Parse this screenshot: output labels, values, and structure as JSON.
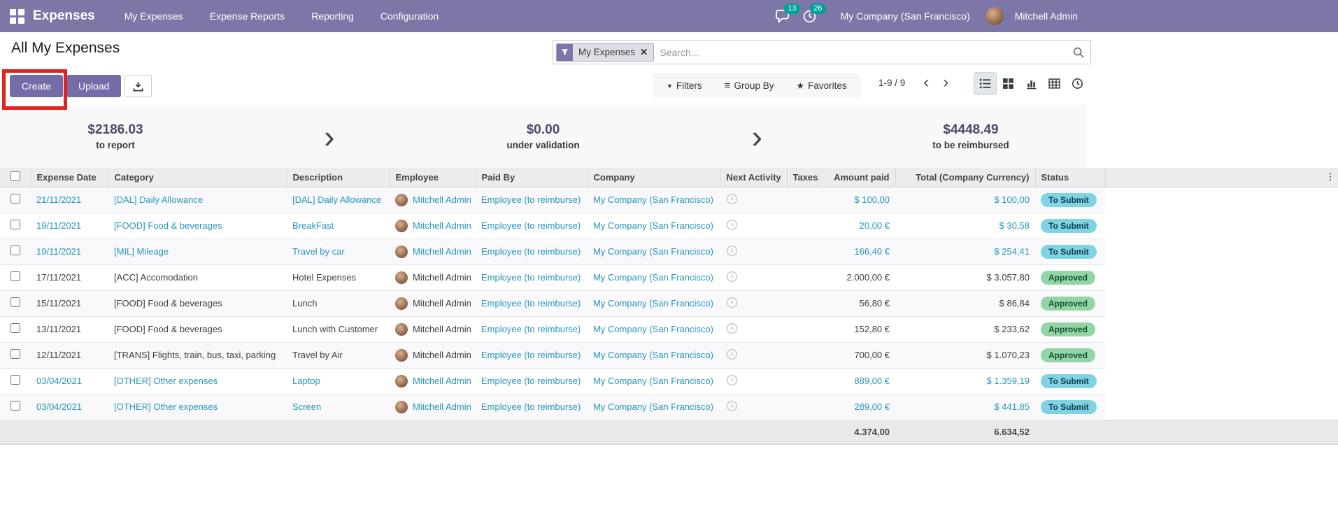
{
  "topbar": {
    "app_name": "Expenses",
    "menus": [
      "My Expenses",
      "Expense Reports",
      "Reporting",
      "Configuration"
    ],
    "messages_count": "13",
    "activities_count": "26",
    "company": "My Company (San Francisco)",
    "user": "Mitchell Admin"
  },
  "control_panel": {
    "title": "All My Expenses",
    "create_label": "Create",
    "upload_label": "Upload",
    "facet_label": "My Expenses",
    "search_placeholder": "Search...",
    "filters_label": "Filters",
    "group_by_label": "Group By",
    "favorites_label": "Favorites",
    "pager": "1-9 / 9"
  },
  "stats": [
    {
      "amount": "$2186.03",
      "label": "to report"
    },
    {
      "amount": "$0.00",
      "label": "under validation"
    },
    {
      "amount": "$4448.49",
      "label": "to be reimbursed"
    }
  ],
  "table": {
    "headers": [
      "Expense Date",
      "Category",
      "Description",
      "Employee",
      "Paid By",
      "Company",
      "Next Activity",
      "Taxes",
      "Amount paid",
      "Total (Company Currency)",
      "Status"
    ],
    "rows": [
      {
        "date": "21/11/2021",
        "category": "[DAL] Daily Allowance",
        "description": "[DAL] Daily Allowance",
        "employee": "Mitchell Admin",
        "paid_by": "Employee (to reimburse)",
        "company": "My Company (San Francisco)",
        "taxes": "",
        "amount_paid": "$ 100,00",
        "total": "$ 100,00",
        "status": "To Submit",
        "state": "to-submit"
      },
      {
        "date": "19/11/2021",
        "category": "[FOOD] Food & beverages",
        "description": "BreakFast",
        "employee": "Mitchell Admin",
        "paid_by": "Employee (to reimburse)",
        "company": "My Company (San Francisco)",
        "taxes": "",
        "amount_paid": "20,00 €",
        "total": "$ 30,58",
        "status": "To Submit",
        "state": "to-submit"
      },
      {
        "date": "19/11/2021",
        "category": "[MIL] Mileage",
        "description": "Travel by car",
        "employee": "Mitchell Admin",
        "paid_by": "Employee (to reimburse)",
        "company": "My Company (San Francisco)",
        "taxes": "",
        "amount_paid": "166,40 €",
        "total": "$ 254,41",
        "status": "To Submit",
        "state": "to-submit"
      },
      {
        "date": "17/11/2021",
        "category": "[ACC] Accomodation",
        "description": "Hotel Expenses",
        "employee": "Mitchell Admin",
        "paid_by": "Employee (to reimburse)",
        "company": "My Company (San Francisco)",
        "taxes": "",
        "amount_paid": "2.000,00 €",
        "total": "$ 3.057,80",
        "status": "Approved",
        "state": "approved"
      },
      {
        "date": "15/11/2021",
        "category": "[FOOD] Food & beverages",
        "description": "Lunch",
        "employee": "Mitchell Admin",
        "paid_by": "Employee (to reimburse)",
        "company": "My Company (San Francisco)",
        "taxes": "",
        "amount_paid": "56,80 €",
        "total": "$ 86,84",
        "status": "Approved",
        "state": "approved"
      },
      {
        "date": "13/11/2021",
        "category": "[FOOD] Food & beverages",
        "description": "Lunch with Customer",
        "employee": "Mitchell Admin",
        "paid_by": "Employee (to reimburse)",
        "company": "My Company (San Francisco)",
        "taxes": "",
        "amount_paid": "152,80 €",
        "total": "$ 233,62",
        "status": "Approved",
        "state": "approved"
      },
      {
        "date": "12/11/2021",
        "category": "[TRANS] Flights, train, bus, taxi, parking",
        "description": "Travel by Air",
        "employee": "Mitchell Admin",
        "paid_by": "Employee (to reimburse)",
        "company": "My Company (San Francisco)",
        "taxes": "",
        "amount_paid": "700,00 €",
        "total": "$ 1.070,23",
        "status": "Approved",
        "state": "approved"
      },
      {
        "date": "03/04/2021",
        "category": "[OTHER] Other expenses",
        "description": "Laptop",
        "employee": "Mitchell Admin",
        "paid_by": "Employee (to reimburse)",
        "company": "My Company (San Francisco)",
        "taxes": "",
        "amount_paid": "889,00 €",
        "total": "$ 1.359,19",
        "status": "To Submit",
        "state": "to-submit"
      },
      {
        "date": "03/04/2021",
        "category": "[OTHER] Other expenses",
        "description": "Screen",
        "employee": "Mitchell Admin",
        "paid_by": "Employee (to reimburse)",
        "company": "My Company (San Francisco)",
        "taxes": "",
        "amount_paid": "289,00 €",
        "total": "$ 441,85",
        "status": "To Submit",
        "state": "to-submit"
      }
    ],
    "totals": {
      "amount_paid": "4.374,00",
      "total": "6.634,52"
    }
  },
  "icons": {
    "apps_menu": "apps-grid-icon",
    "messages": "chat-bubble-icon",
    "activities": "clock-icon",
    "download": "download-icon",
    "facet": "funnel-icon",
    "search": "magnifier-icon",
    "filters": "caret-down-icon",
    "group_by": "bars-icon",
    "favorites": "star-icon",
    "views": [
      "list-view-icon",
      "kanban-view-icon",
      "graph-view-icon",
      "pivot-view-icon",
      "activity-view-icon"
    ],
    "next_activity": "clock-outline-icon",
    "optional_columns": "vertical-dots-icon"
  },
  "colors": {
    "topbar_bg": "#7d77a8",
    "button_primary": "#746ca8",
    "link": "#2596be",
    "badge_teal": "#00a09d",
    "annotation_red": "#e0231c",
    "status_to_submit_bg": "#7fd3e3",
    "status_to_submit_text": "#073e4d",
    "status_approved_bg": "#93d5a6",
    "status_approved_text": "#14512e",
    "stat_amount": "#4c4a69"
  }
}
